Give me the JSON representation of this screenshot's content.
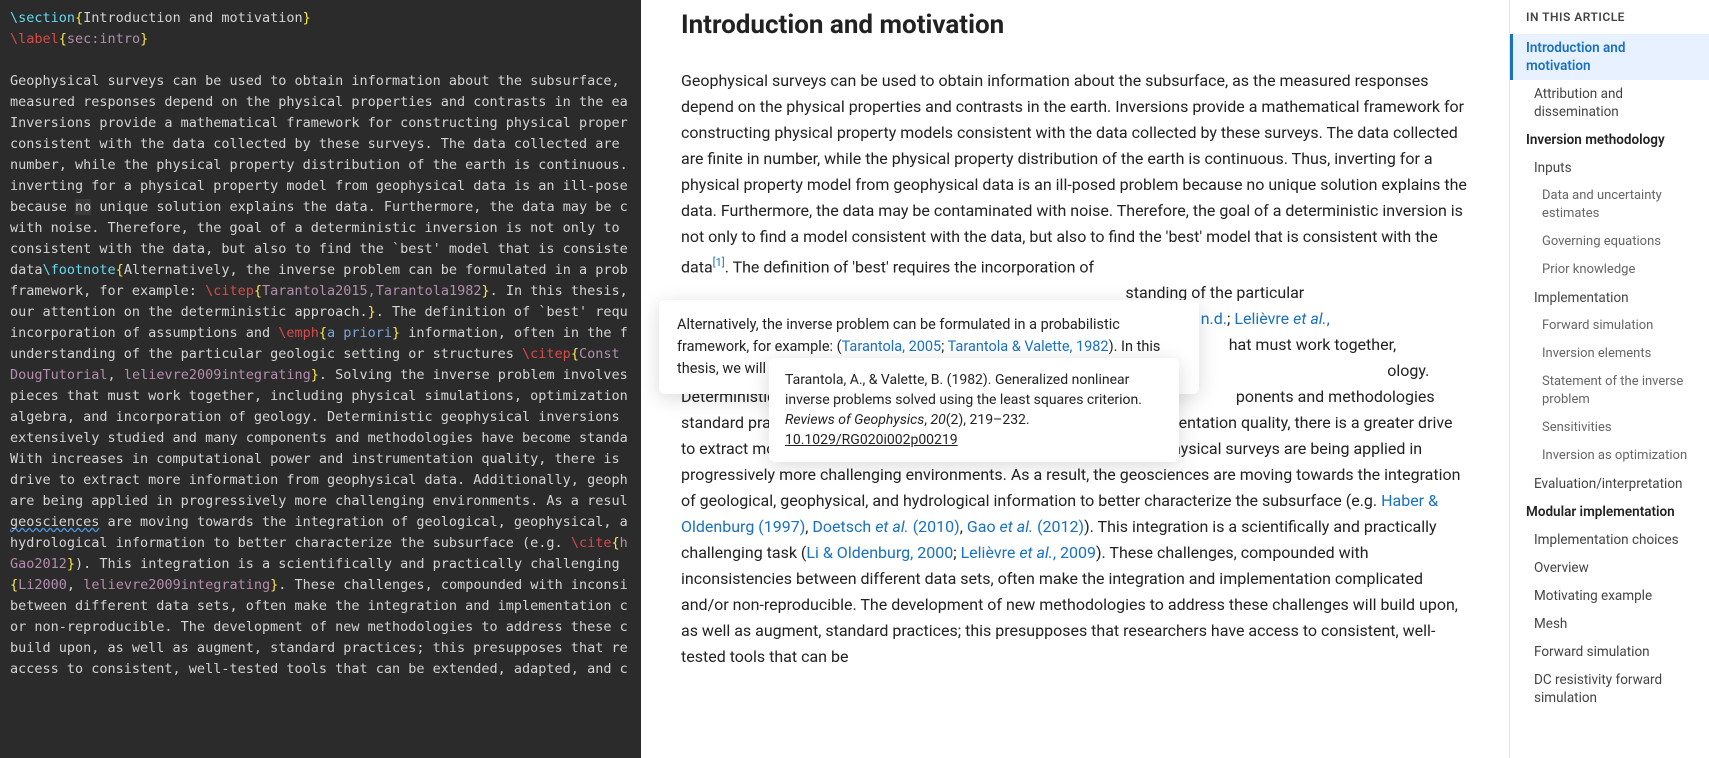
{
  "editor": {
    "section_cmd": "\\section",
    "section_title": "Introduction and motivation",
    "label_cmd": "\\label",
    "label_arg": "sec:intro",
    "body1": "Geophysical surveys can be used to obtain information about the subsurface, measured responses depend on the physical properties and contrasts in the ea",
    "body2": "Inversions provide a mathematical framework for constructing physical proper",
    "body3": "consistent with the data collected by these surveys. The data collected are ",
    "body4": "number, while the physical property distribution of the earth is continuous.",
    "body5": "inverting for a physical property model from geophysical data is an ill-pose",
    "body6a": "because ",
    "body6_hl": "no",
    "body6b": " unique solution explains the data. Furthermore, the data may be c",
    "body7": "with noise. Therefore, the goal of a deterministic inversion is not only to ",
    "body8": "consistent with the data, but also to find the `best' model that is consiste",
    "body9": "data",
    "footnote_cmd": "\\footnote",
    "fn_text": "Alternatively, the inverse problem can be formulated in a prob",
    "fn_text2": "framework, for example: ",
    "citep_cmd": "\\citep",
    "cite_keys1": "Tarantola2015,",
    "cite_keys1b": "Tarantola1982",
    "fn_tail": ". In this thesis,",
    "body10": "our attention on the deterministic approach.",
    "body10_tail": ". The definition of `best' requ",
    "body11a": "incorporation of assumptions and ",
    "emph_cmd": "\\emph",
    "emph_arg": "a priori",
    "body11b": " information, often in the f",
    "body12": "understanding of the particular geologic setting or structures ",
    "cite_keys2": "Const",
    "cite_keys3a": "DougTutorial",
    "cite_keys3b": ", ",
    "cite_keys3c": "lelievre2009integrating",
    "body12_tail": ". Solving the inverse problem involves",
    "body13": "pieces that must work together, including physical simulations, optimization",
    "body14": "algebra, and incorporation of geology. Deterministic geophysical inversions ",
    "body15": "extensively studied and many components and methodologies have become standa",
    "body16": "With increases in computational power and instrumentation quality, there is ",
    "body17": "drive to extract more information from geophysical data. Additionally, geoph",
    "body18": "are being applied in progressively more challenging environments. As a resul",
    "body19a_wavy": "geosciences",
    "body19b": " are moving towards the integration of geological, geophysical, a",
    "body20": "hydrological information to better characterize the subsurface (e.g. ",
    "cite_cmd": "\\cite",
    "cite_h": "h",
    "cite_gao": "Gao2012",
    "body20_tail": "). This integration is a scientifically and practically challenging ",
    "cite_li": "Li2000",
    "cite_lel": "lelievre2009integrating",
    "body21_tail": ". These challenges, compounded with inconsi",
    "body22": "between different data sets, often make the integration and implementation c",
    "body23": "or non-reproducible. The development of new methodologies to address these c",
    "body24": "build upon, as well as augment, standard practices; this presupposes that re",
    "body25": "access to consistent, well-tested tools that can be extended, adapted, and c"
  },
  "preview": {
    "heading": "Introduction and motivation",
    "para_a": "Geophysical surveys can be used to obtain information about the subsurface, as the measured responses depend on the physical properties and contrasts in the earth. Inversions provide a mathematical framework for constructing physical property models consistent with the data collected by these surveys. The data collected are finite in number, while the physical property distribution of the earth is continuous. Thus, inverting for a physical property model from geophysical data is an ill-posed problem because no unique solution explains the data. Furthermore, the data may be contaminated with noise. Therefore, the goal of a deterministic inversion is not only to find a model consistent with the data, but also to find the 'best' model that is consistent with the data",
    "sup": "[1]",
    "para_b": ". The definition of 'best' requires the incorporation of",
    "para_c_tail": "standing of the particular",
    "links": {
      "li_nd": "Li, n.d.",
      "lelievre_etal": "et al.",
      "lelievre_pre": "Lelièvre "
    },
    "para_d_tail": "hat must work together,",
    "para_e_tail": "ology.",
    "para_f_start": "Deterministic",
    "para_f_tail": "ponents and methodologies",
    "para_g": " standard practice. With increases in computational power and instrumentation quality, there is a greater drive to extract more information from geophysical data. Additionally, geophysical surveys are being applied in progressively more challenging environments. As a result, the geosciences are moving towards the integration of geological, geophysical, and hydrological information to better characterize the subsurface (e.g. ",
    "link_haber": "Haber & Oldenburg (1997)",
    "link_doetsch_pre": "Doetsch ",
    "link_doetsch_et": "et al.",
    "link_doetsch_yr": " (2010)",
    "link_gao_pre": "Gao ",
    "link_gao_et": "et al.",
    "link_gao_yr": " (2012)",
    "para_h": "). This integration is a scientifically and practically challenging task (",
    "link_li2000": "Li & Oldenburg, 2000",
    "sep": "; ",
    "link_lel_pre": "Lelièvre ",
    "link_lel_et": "et al.",
    "link_lel_yr": ", 2009",
    "para_i": "). These challenges, compounded with inconsistencies between different data sets, often make the integration and implementation complicated and/or non-reproducible. The development of new methodologies to address these challenges will build upon, as well as augment, standard practices; this presupposes that researchers have access to consistent, well-tested tools that can be"
  },
  "tooltip1": {
    "text_a": "Alternatively, the inverse problem can be formulated in a probabilistic framework, for example: (",
    "link1": "Tarantola, 2005",
    "sep": "; ",
    "link2": "Tarantola & Valette, 1982",
    "text_b": "). In this thesis, we will focus our attention on the deterministic approach."
  },
  "tooltip2": {
    "text": "Tarantola, A., & Valette, B. (1982). Generalized nonlinear inverse problems solved using the least squares criterion. ",
    "journal": "Reviews of Geophysics",
    "vol": ", ",
    "vol_it": "20",
    "issue": "(2), 219–232. ",
    "doi": "10.1029/RG020i002p00219"
  },
  "toc": {
    "title": "IN THIS ARTICLE",
    "items": [
      {
        "label": "Introduction and motivation",
        "level": 1,
        "active": true
      },
      {
        "label": "Attribution and dissemination",
        "level": 2
      },
      {
        "label": "Inversion methodology",
        "level": 1
      },
      {
        "label": "Inputs",
        "level": 2
      },
      {
        "label": "Data and uncertainty estimates",
        "level": 3
      },
      {
        "label": "Governing equations",
        "level": 3
      },
      {
        "label": "Prior knowledge",
        "level": 3
      },
      {
        "label": "Implementation",
        "level": 2
      },
      {
        "label": "Forward simulation",
        "level": 3
      },
      {
        "label": "Inversion elements",
        "level": 3
      },
      {
        "label": "Statement of the inverse problem",
        "level": 3
      },
      {
        "label": "Sensitivities",
        "level": 3
      },
      {
        "label": "Inversion as optimization",
        "level": 3
      },
      {
        "label": "Evaluation/interpretation",
        "level": 2
      },
      {
        "label": "Modular implementation",
        "level": 1
      },
      {
        "label": "Implementation choices",
        "level": 2
      },
      {
        "label": "Overview",
        "level": 2
      },
      {
        "label": "Motivating example",
        "level": 2
      },
      {
        "label": "Mesh",
        "level": 2
      },
      {
        "label": "Forward simulation",
        "level": 2
      },
      {
        "label": "DC resistivity forward simulation",
        "level": 2
      }
    ]
  }
}
